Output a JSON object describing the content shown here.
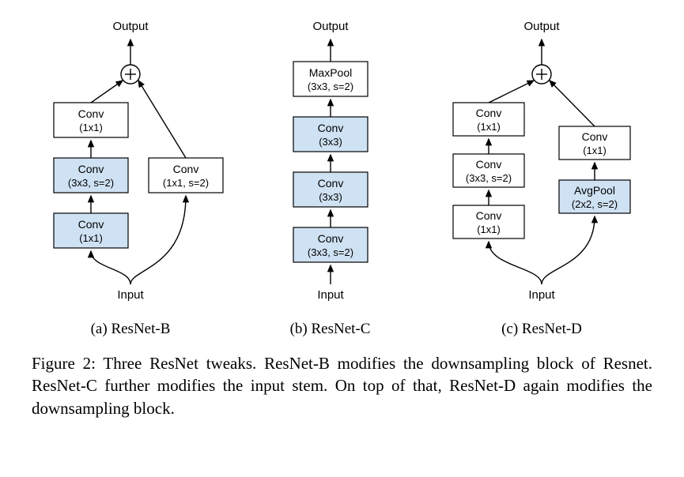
{
  "figure_label": "Figure 2:",
  "caption_rest": "  Three ResNet tweaks.  ResNet-B modifies the downsampling block of Resnet. ResNet-C further modifies the input stem. On top of that, ResNet-D again modifies the downsampling block.",
  "io": {
    "input": "Input",
    "output": "Output"
  },
  "panels": {
    "a": {
      "subcaption": "(a) ResNet-B",
      "left": [
        {
          "l1": "Conv",
          "l2": "(1x1)",
          "blue": true
        },
        {
          "l1": "Conv",
          "l2": "(3x3, s=2)",
          "blue": true
        },
        {
          "l1": "Conv",
          "l2": "(1x1)",
          "blue": false
        }
      ],
      "right": [
        {
          "l1": "Conv",
          "l2": "(1x1, s=2)",
          "blue": false
        }
      ]
    },
    "b": {
      "subcaption": "(b) ResNet-C",
      "stack": [
        {
          "l1": "Conv",
          "l2": "(3x3, s=2)",
          "blue": true
        },
        {
          "l1": "Conv",
          "l2": "(3x3)",
          "blue": true
        },
        {
          "l1": "Conv",
          "l2": "(3x3)",
          "blue": true
        },
        {
          "l1": "MaxPool",
          "l2": "(3x3, s=2)",
          "blue": false
        }
      ]
    },
    "c": {
      "subcaption": "(c) ResNet-D",
      "left": [
        {
          "l1": "Conv",
          "l2": "(1x1)",
          "blue": false
        },
        {
          "l1": "Conv",
          "l2": "(3x3, s=2)",
          "blue": false
        },
        {
          "l1": "Conv",
          "l2": "(1x1)",
          "blue": false
        }
      ],
      "right": [
        {
          "l1": "AvgPool",
          "l2": "(2x2, s=2)",
          "blue": true
        },
        {
          "l1": "Conv",
          "l2": "(1x1)",
          "blue": false
        }
      ]
    }
  }
}
